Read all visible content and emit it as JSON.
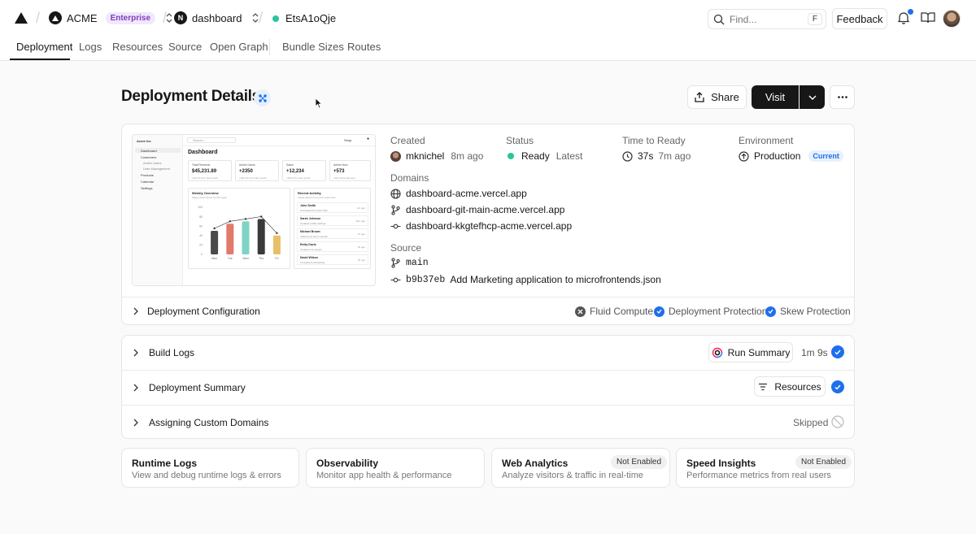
{
  "header": {
    "org": "ACME",
    "plan": "Enterprise",
    "project": "dashboard",
    "deployment_id": "EtsA1oQje",
    "search_placeholder": "Find...",
    "search_shortcut": "F",
    "feedback_label": "Feedback"
  },
  "tabs": [
    "Deployment",
    "Logs",
    "Resources",
    "Source",
    "Open Graph",
    "Bundle Sizes",
    "Routes"
  ],
  "page": {
    "title": "Deployment Details",
    "share_label": "Share",
    "visit_label": "Visit"
  },
  "details": {
    "created_label": "Created",
    "created_user": "mknichel",
    "created_ago": "8m ago",
    "status_label": "Status",
    "status_value": "Ready",
    "status_tag": "Latest",
    "ttr_label": "Time to Ready",
    "ttr_value": "37s",
    "ttr_ago": "7m ago",
    "env_label": "Environment",
    "env_value": "Production",
    "env_badge": "Current",
    "domains_label": "Domains",
    "domains": [
      "dashboard-acme.vercel.app",
      "dashboard-git-main-acme.vercel.app",
      "dashboard-kkgtefhcp-acme.vercel.app"
    ],
    "source_label": "Source",
    "branch": "main",
    "commit_sha": "b9b37eb",
    "commit_msg": "Add Marketing application to microfrontends.json"
  },
  "config": {
    "title": "Deployment Configuration",
    "fluid_compute": "Fluid Compute",
    "deployment_protection": "Deployment Protection",
    "skew_protection": "Skew Protection"
  },
  "steps": {
    "build_logs": "Build Logs",
    "run_summary": "Run Summary",
    "build_time": "1m 9s",
    "deployment_summary": "Deployment Summary",
    "resources": "Resources",
    "custom_domains": "Assigning Custom Domains",
    "skipped": "Skipped"
  },
  "bottom_cards": [
    {
      "title": "Runtime Logs",
      "desc": "View and debug runtime logs & errors",
      "badge": ""
    },
    {
      "title": "Observability",
      "desc": "Monitor app health & performance",
      "badge": ""
    },
    {
      "title": "Web Analytics",
      "desc": "Analyze visitors & traffic in real-time",
      "badge": "Not Enabled"
    },
    {
      "title": "Speed Insights",
      "desc": "Performance metrics from real users",
      "badge": "Not Enabled"
    }
  ],
  "thumbnail": {
    "brand": "Acme Inc",
    "search": "Search...",
    "shop": "Shop",
    "heading": "Dashboard",
    "nav": [
      "Dashboard",
      "Customers",
      "Active Users",
      "User Management",
      "Products",
      "Calendar",
      "Settings"
    ],
    "stats": [
      {
        "label": "Total Revenue",
        "value": "$45,231.89",
        "sub": "+20.1% from last month"
      },
      {
        "label": "Active Users",
        "value": "+2350",
        "sub": "+180.1% from last month"
      },
      {
        "label": "Sales",
        "value": "+12,234",
        "sub": "+19% from last month"
      },
      {
        "label": "Active Now",
        "value": "+573",
        "sub": "+201 since last hour"
      }
    ],
    "overview_title": "Weekly Overview",
    "overview_sub": "Sales performance for this week",
    "bar_days": [
      "Mon",
      "Tue",
      "Wed",
      "Thu",
      "Fri"
    ],
    "bar_values": [
      50,
      65,
      70,
      75,
      40
    ],
    "y_ticks": [
      "100",
      "80",
      "60",
      "40",
      "20",
      "0"
    ],
    "activity_title": "Recent Activity",
    "activity_sub": "Latest actions from your customers",
    "activity": [
      {
        "name": "John Smith",
        "action": "Purchased Premium Plan",
        "time": "2m ago"
      },
      {
        "name": "Sarah Johnson",
        "action": "Updated profile settings",
        "time": "15m ago"
      },
      {
        "name": "Michael Brown",
        "action": "Added new team member",
        "time": "1h ago"
      },
      {
        "name": "Emily Davis",
        "action": "Created new project",
        "time": "3h ago"
      },
      {
        "name": "David Wilson",
        "action": "Completed onboarding",
        "time": "5h ago"
      }
    ]
  },
  "colors": {
    "accent_blue": "#1f6feb",
    "ready_green": "#2bc59a",
    "dark": "#171717"
  }
}
